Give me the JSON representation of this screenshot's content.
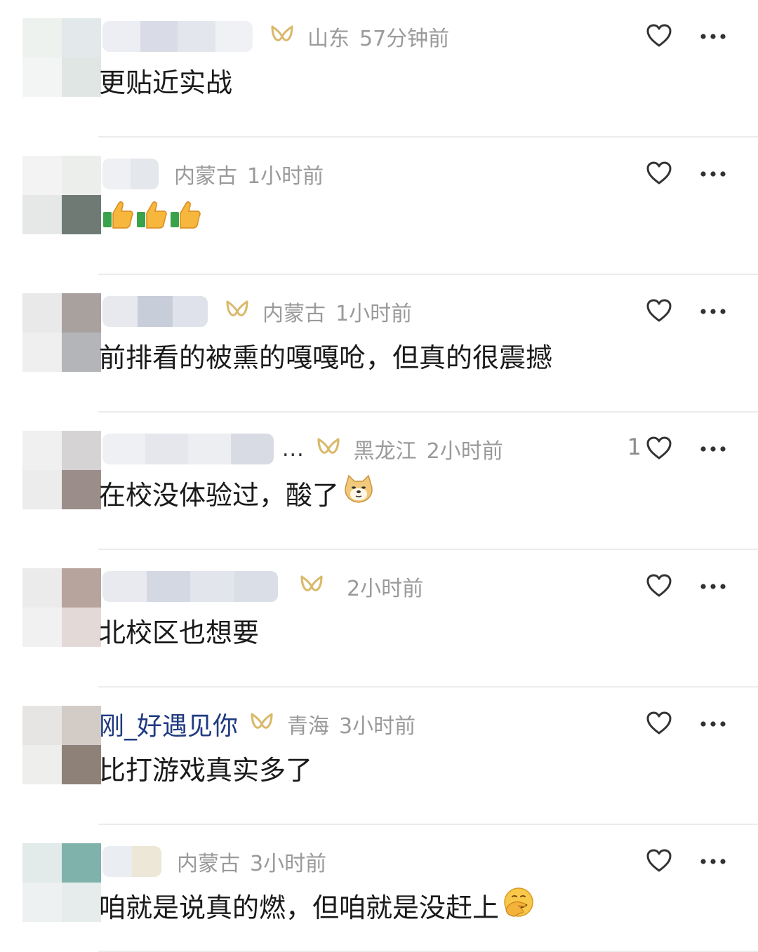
{
  "comments": [
    {
      "username": "",
      "region": "山东",
      "time": "57分钟前",
      "text": "更贴近实战",
      "likes": "",
      "emoji": "",
      "badge": true,
      "ellipsis": ""
    },
    {
      "username": "",
      "region": "内蒙古",
      "time": "1小时前",
      "text": "",
      "likes": "",
      "emoji": "thumbs-up-x3",
      "badge": false,
      "ellipsis": ""
    },
    {
      "username": "",
      "region": "内蒙古",
      "time": "1小时前",
      "text": "前排看的被熏的嘎嘎呛，但真的很震撼",
      "likes": "",
      "emoji": "",
      "badge": true,
      "ellipsis": ""
    },
    {
      "username": "",
      "region": "黑龙江",
      "time": "2小时前",
      "text": "在校没体验过，酸了",
      "likes": "1",
      "emoji": "doge",
      "badge": true,
      "ellipsis": "..."
    },
    {
      "username": "",
      "region": "",
      "time": "2小时前",
      "text": "北校区也想要",
      "likes": "",
      "emoji": "",
      "badge": true,
      "ellipsis": ""
    },
    {
      "username": "刚_好遇见你",
      "region": "青海",
      "time": "3小时前",
      "text": "比打游戏真实多了",
      "likes": "",
      "emoji": "",
      "badge": true,
      "ellipsis": ""
    },
    {
      "username": "",
      "region": "内蒙古",
      "time": "3小时前",
      "text": "咱就是说真的燃，但咱就是没赶上",
      "likes": "",
      "emoji": "facepalm",
      "badge": false,
      "ellipsis": ""
    }
  ],
  "colors": {
    "username": "#1f3a80",
    "meta": "#9a9a9a",
    "badge": "#d9b96a",
    "icon": "#333333"
  },
  "icons": {
    "like": "heart-outline-icon",
    "more": "more-dots-icon",
    "badge": "gold-badge-icon"
  }
}
